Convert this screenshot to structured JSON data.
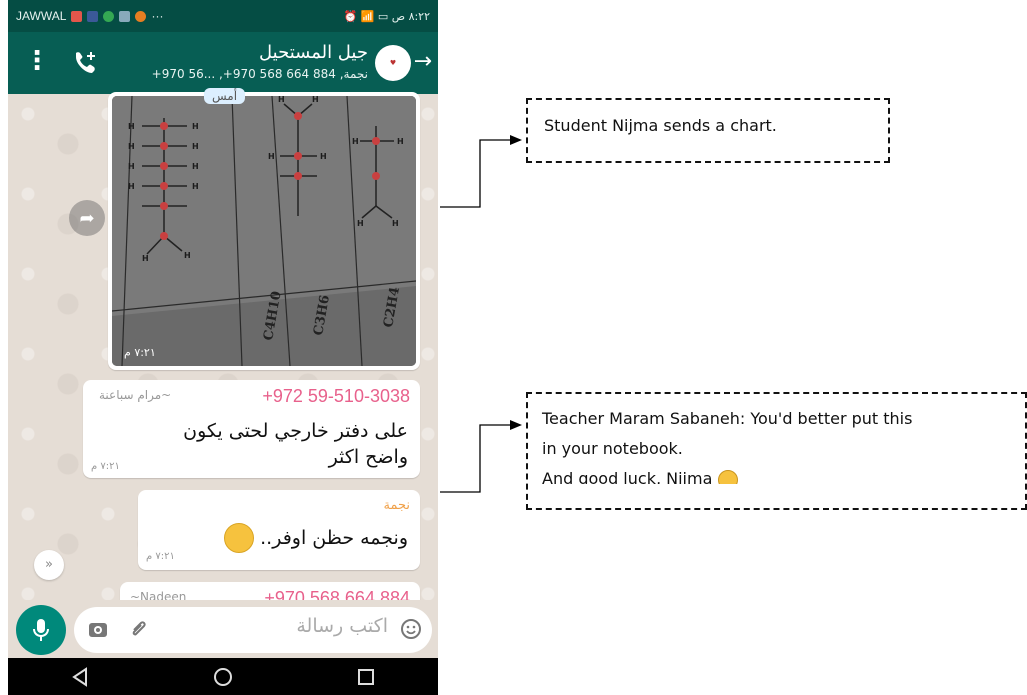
{
  "statusbar": {
    "carrier": "JAWWAL",
    "right": "٨:٢٢ ص"
  },
  "header": {
    "title": "جيل المستحيل",
    "subtitle": "+970 56... ,+970 568 664 884 ,نجمة"
  },
  "chat": {
    "day_chip": "أمس",
    "image_time": "٧:٢١ م",
    "image_formulas": [
      "C4H10",
      "C3H6",
      "C2H4"
    ],
    "message1": {
      "sender_phone": "+972 59-510-3038",
      "sender_alias": "~مرام سباعنة",
      "line1": "على دفتر خارجي لحتى يكون",
      "line2": "واضح اكثر",
      "time": "٧:٢١ م"
    },
    "message2": {
      "sender": "نجمة",
      "text": "ونجمه حظن اوفر..",
      "time": "٧:٢١ م"
    },
    "message3": {
      "sender_alias": "~Nadeen",
      "sender_phone": "+970 568 664 884"
    }
  },
  "composer": {
    "placeholder": "اكتب رسالة"
  },
  "annotations": {
    "callout1": "Student Nijma sends a chart.",
    "callout2_line1": "Teacher Maram Sabaneh: You'd better put this",
    "callout2_line2": "in your notebook.",
    "callout2_line3": "And good luck, Nijma"
  },
  "colors": {
    "header": "#075e54",
    "statusbar": "#054d44",
    "accent_pink": "#e8618c",
    "accent_orange": "#f0a14a",
    "mic": "#00897b"
  }
}
